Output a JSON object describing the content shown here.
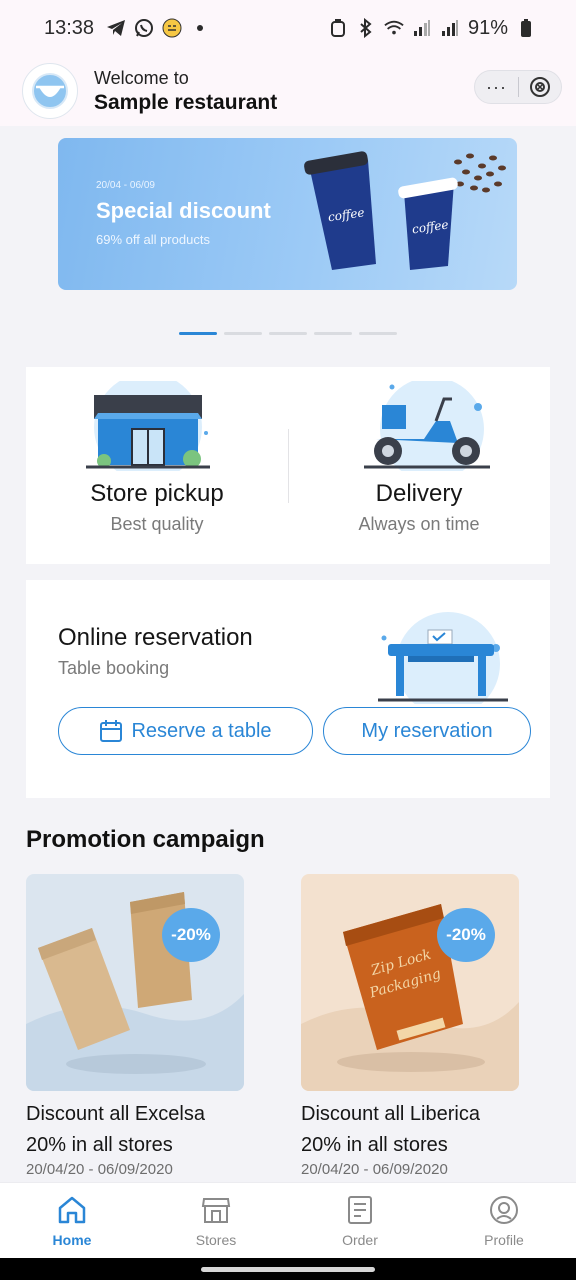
{
  "status_bar": {
    "time": "13:38",
    "battery": "91%"
  },
  "header": {
    "welcome": "Welcome to",
    "restaurant_name": "Sample restaurant",
    "more_label": "···"
  },
  "banner": {
    "date_range": "20/04 - 06/09",
    "title": "Special discount",
    "subtitle": "69% off all products",
    "cup_text": "coffee",
    "slide_count": 5,
    "active_slide": 1
  },
  "services": [
    {
      "title": "Store pickup",
      "subtitle": "Best quality"
    },
    {
      "title": "Delivery",
      "subtitle": "Always on time"
    }
  ],
  "reservation": {
    "title": "Online reservation",
    "subtitle": "Table booking",
    "reserve_button": "Reserve a table",
    "my_reservation_button": "My reservation"
  },
  "promotion": {
    "heading": "Promotion campaign",
    "items": [
      {
        "line1": "Discount all Excelsa",
        "line2": "20% in all stores",
        "dates": "20/04/20 - 06/09/2020",
        "badge": "-20%"
      },
      {
        "line1": "Discount all Liberica",
        "line2": "20% in all stores",
        "dates": "20/04/20 - 06/09/2020",
        "badge": "-20%",
        "package_text_1": "Zip Lock",
        "package_text_2": "Packaging"
      }
    ]
  },
  "nav": {
    "items": [
      {
        "label": "Home",
        "icon": "home-icon",
        "active": true
      },
      {
        "label": "Stores",
        "icon": "store-icon",
        "active": false
      },
      {
        "label": "Order",
        "icon": "order-icon",
        "active": false
      },
      {
        "label": "Profile",
        "icon": "profile-icon",
        "active": false
      }
    ]
  },
  "colors": {
    "accent": "#2a86d6",
    "background": "#f3f3f7",
    "badge": "#5aa9ea"
  }
}
